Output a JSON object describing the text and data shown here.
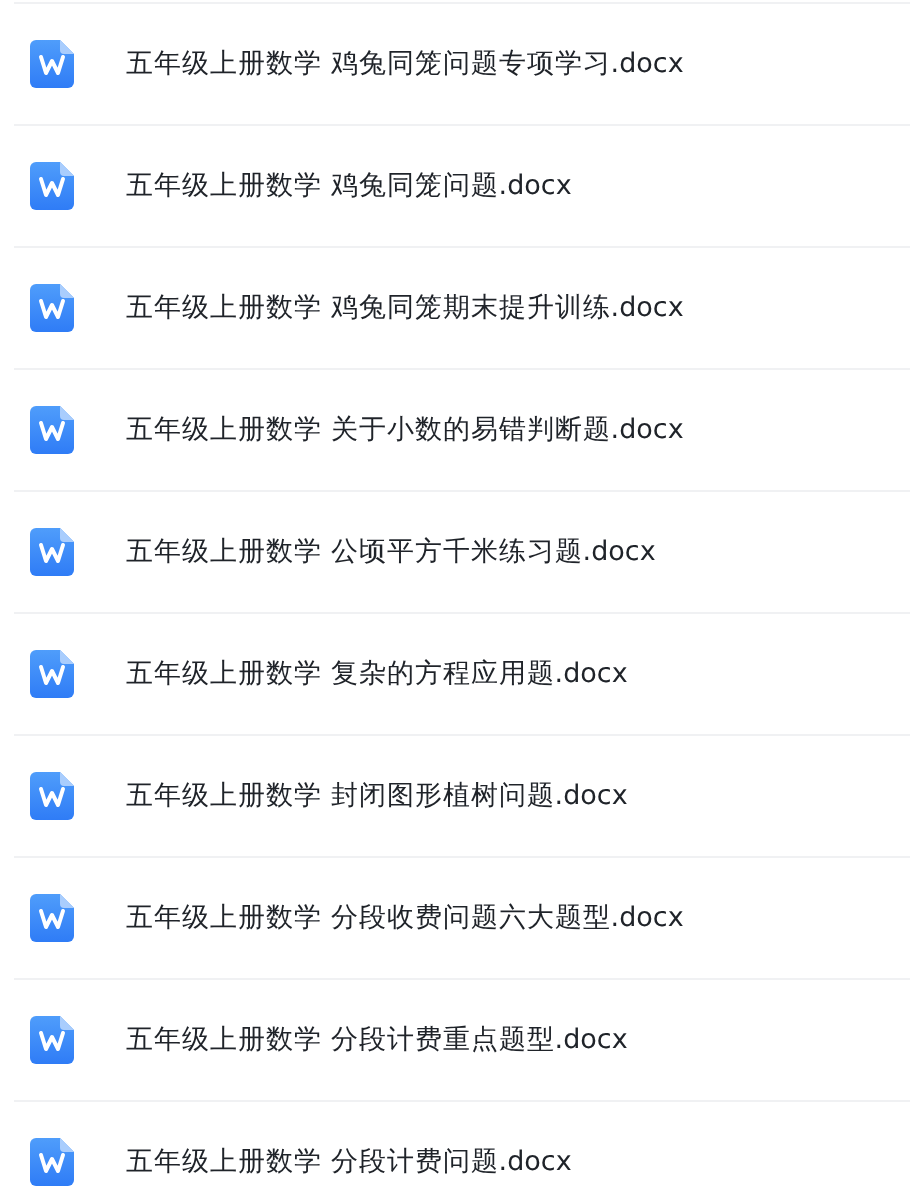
{
  "files": [
    {
      "name": "五年级上册数学 鸡兔同笼问题专项学习.docx"
    },
    {
      "name": "五年级上册数学 鸡兔同笼问题.docx"
    },
    {
      "name": "五年级上册数学 鸡兔同笼期末提升训练.docx"
    },
    {
      "name": "五年级上册数学 关于小数的易错判断题.docx"
    },
    {
      "name": "五年级上册数学 公顷平方千米练习题.docx"
    },
    {
      "name": "五年级上册数学 复杂的方程应用题.docx"
    },
    {
      "name": "五年级上册数学 封闭图形植树问题.docx"
    },
    {
      "name": "五年级上册数学 分段收费问题六大题型.docx"
    },
    {
      "name": "五年级上册数学 分段计费重点题型.docx"
    },
    {
      "name": "五年级上册数学 分段计费问题.docx"
    }
  ]
}
